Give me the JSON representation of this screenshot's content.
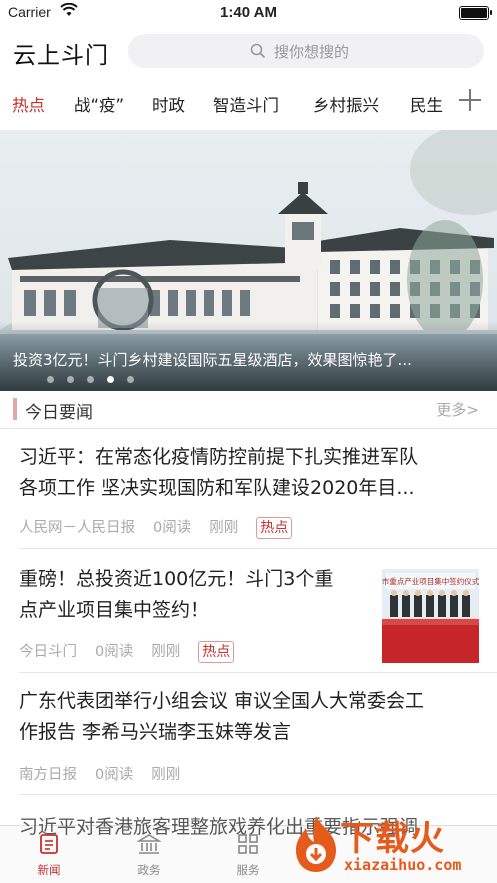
{
  "status_bar": {
    "carrier": "Carrier",
    "time": "1:40 AM"
  },
  "header": {
    "app_title": "云上斗门",
    "search_placeholder": "搜你想搜的"
  },
  "tabs": [
    {
      "label": "热点",
      "active": true
    },
    {
      "label": "战“疫”"
    },
    {
      "label": "时政"
    },
    {
      "label": "智造斗门"
    },
    {
      "label": "乡村振兴"
    },
    {
      "label": "民生"
    }
  ],
  "banner": {
    "caption": "投资3亿元！斗门乡村建设国际五星级酒店，效果图惊艳了...",
    "active_slide": 4,
    "slide_count": 5
  },
  "section": {
    "title": "今日要闻",
    "more": "更多>"
  },
  "articles": [
    {
      "headline_line1": "习近平：在常态化疫情防控前提下扎实推进军队",
      "headline_line2": "各项工作 坚决实现国防和军队建设2020年目...",
      "source": "人民网－人民日报",
      "reads": "0阅读",
      "time": "刚刚",
      "tag": "热点"
    },
    {
      "headline_line1": "重磅！总投资近100亿元！斗门3个重",
      "headline_line2": "点产业项目集中签约！",
      "source": "今日斗门",
      "reads": "0阅读",
      "time": "刚刚",
      "tag": "热点",
      "thumb_banner_text": "市重点产业项目集中签约仪式"
    },
    {
      "headline_line1": "广东代表团举行小组会议 审议全国人大常委会工",
      "headline_line2": "作报告 李希马兴瑞李玉妹等发言",
      "source": "南方日报",
      "reads": "0阅读",
      "time": "刚刚"
    }
  ],
  "partial_headline": "习近平对香港旅客理整旅戏养化出重要指示强调",
  "tabbar": [
    {
      "label": "新闻",
      "icon": "news-icon",
      "active": true
    },
    {
      "label": "政务",
      "icon": "government-icon"
    },
    {
      "label": "服务",
      "icon": "services-grid-icon"
    }
  ],
  "watermark": {
    "text": "下载火",
    "url": "xiazaihuo.com"
  },
  "colors": {
    "accent": "#c9302c",
    "watermark": "#e65a1c"
  }
}
